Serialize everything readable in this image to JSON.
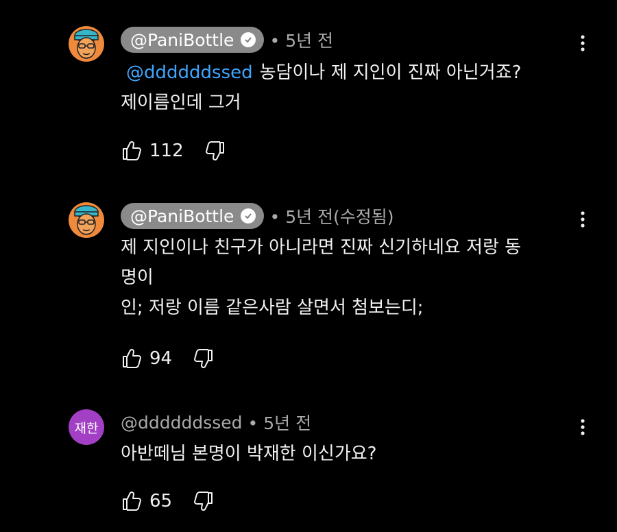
{
  "comments": [
    {
      "author": "@PaniBottle",
      "time": "5년 전",
      "mention": "@ddddddssed",
      "line1": "농담이나 제 지인이 진짜 아닌거죠?",
      "line2": "제이름인데 그거",
      "likes": "112"
    },
    {
      "author": "@PaniBottle",
      "time": "5년 전(수정됨)",
      "line1": "제 지인이나 친구가 아니라면 진짜 신기하네요 저랑 동",
      "line2": "명이",
      "line3": "인; 저랑 이름 같은사람 살면서 첨보는디;",
      "likes": "94"
    },
    {
      "author": "@ddddddssed",
      "avatar_text": "재한",
      "time": "5년 전",
      "line1": "아반떼님 본명이 박재한 이신가요?",
      "likes": "65"
    }
  ],
  "colors": {
    "background": "#000000",
    "owner_chip": "#8a8a8a",
    "mention": "#3ea6ff",
    "avatar_purple": "#a23fc4",
    "avatar_orange": "#ef8a3c",
    "cap_blue": "#35b6c9"
  },
  "icons": [
    "thumbs-up-icon",
    "thumbs-down-icon",
    "more-vert-icon",
    "verified-check-icon"
  ]
}
